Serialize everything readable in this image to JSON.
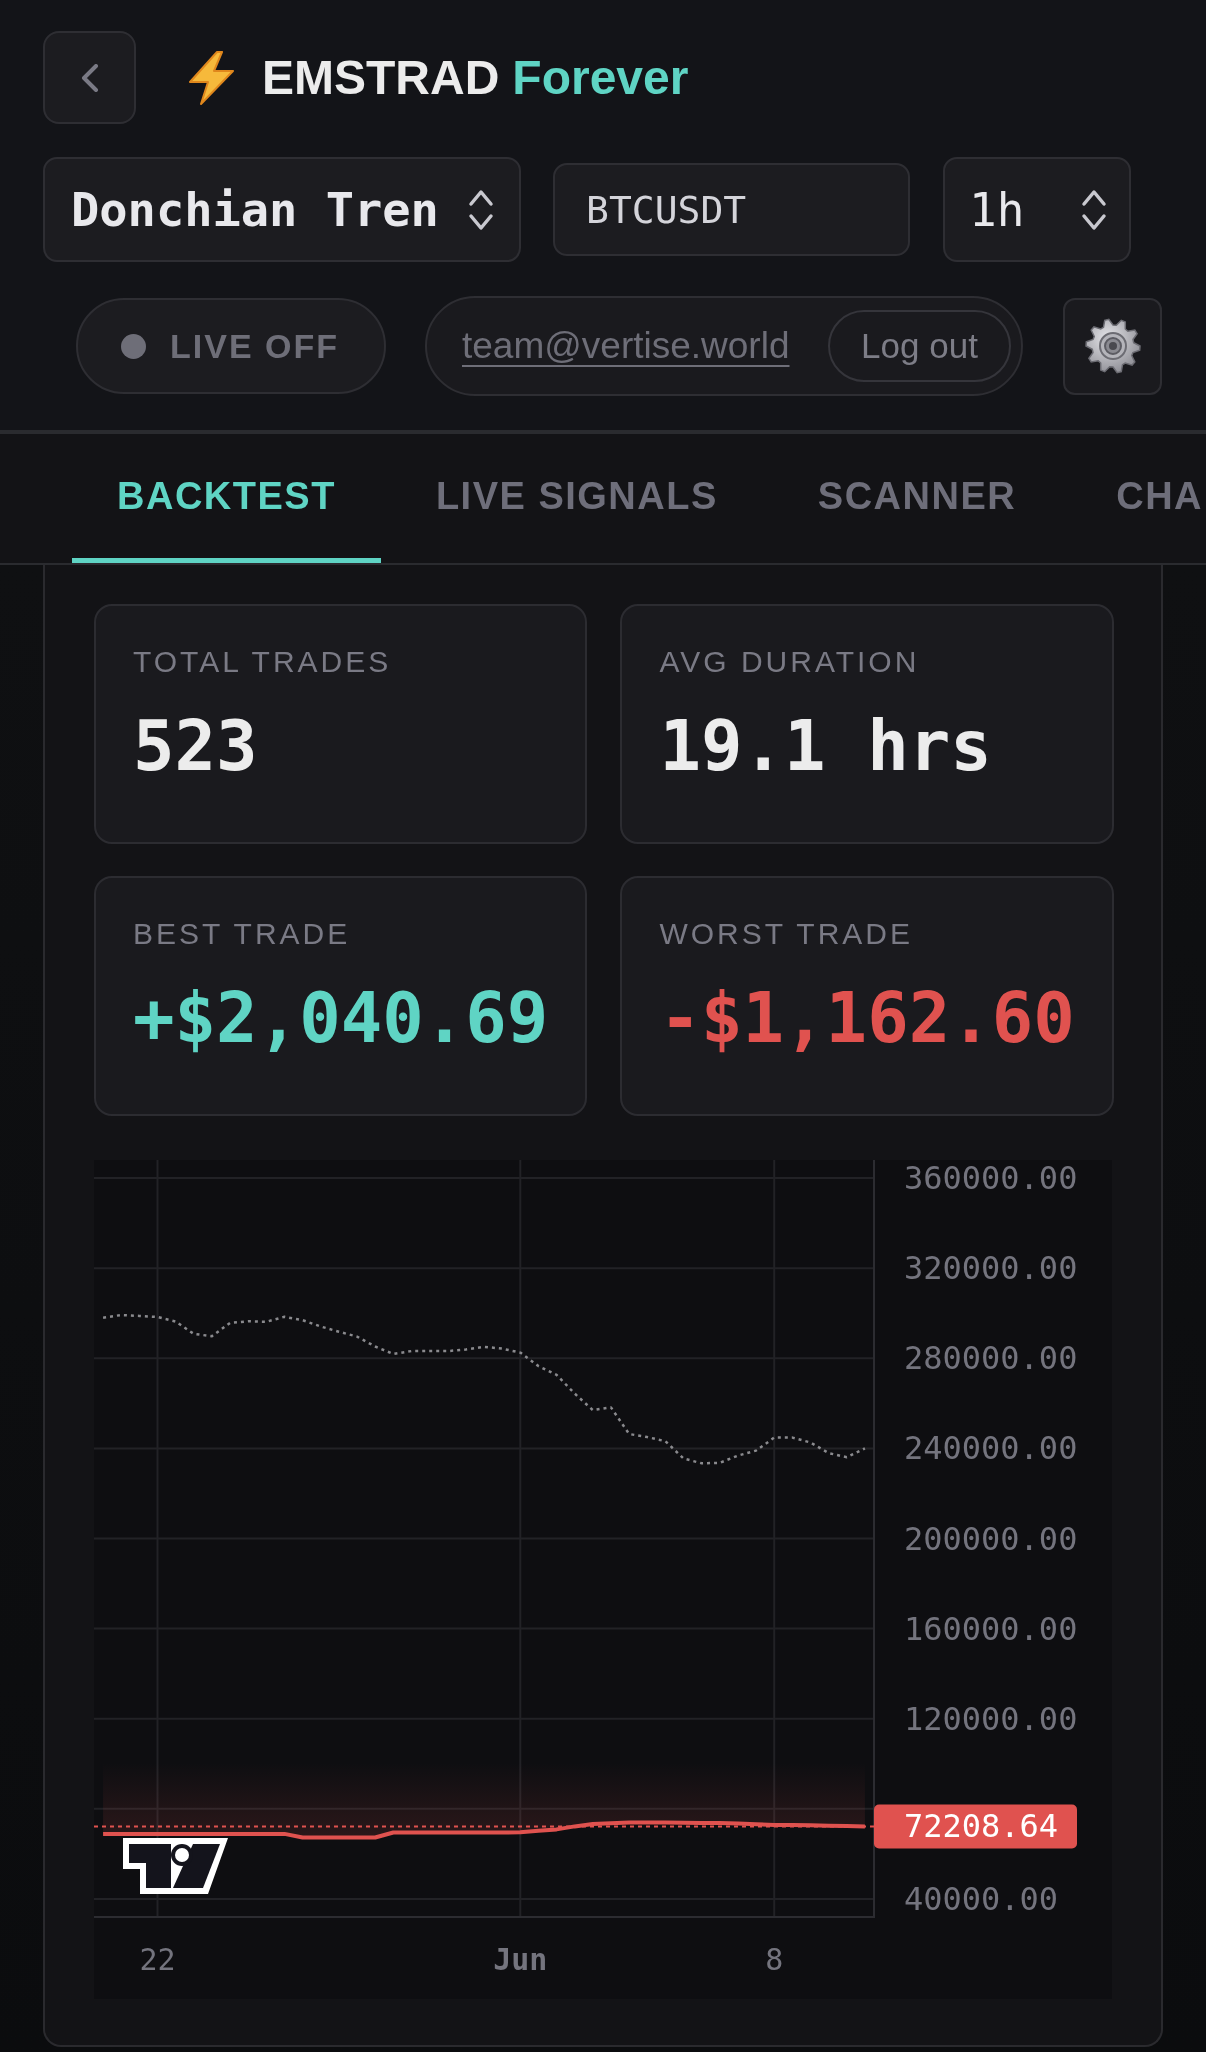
{
  "brand": {
    "name": "EMSTRAD",
    "accent": "Forever"
  },
  "controls": {
    "strategy_select": {
      "value": "Donchian Tren"
    },
    "symbol_input": {
      "value": "BTCUSDT"
    },
    "interval_select": {
      "value": "1h"
    }
  },
  "account_bar": {
    "live_toggle": {
      "label": "LIVE OFF",
      "on": false
    },
    "email": "team@vertise.world",
    "logout_button": "Log out"
  },
  "tabs": [
    {
      "label": "BACKTEST",
      "selected": true
    },
    {
      "label": "LIVE SIGNALS",
      "selected": false
    },
    {
      "label": "SCANNER",
      "selected": false
    },
    {
      "label": "CHA",
      "selected": false
    }
  ],
  "stats": [
    {
      "label": "TOTAL TRADES",
      "value": "523",
      "color": "#ececec"
    },
    {
      "label": "AVG DURATION",
      "value": "19.1 hrs",
      "color": "#ececec"
    },
    {
      "label": "BEST TRADE",
      "value": "+$2,040.69",
      "color": "#5fd4c4"
    },
    {
      "label": "WORST TRADE",
      "value": "-$1,162.60",
      "color": "#e0524f"
    }
  ],
  "chart": {
    "chart_data": {
      "type": "line",
      "grid": true,
      "categories": [
        null,
        null,
        null,
        "22",
        null,
        null,
        null,
        null,
        null,
        null,
        null,
        null,
        null,
        null,
        null,
        null,
        null,
        null,
        null,
        null,
        null,
        null,
        null,
        "Jun",
        null,
        null,
        null,
        null,
        null,
        null,
        null,
        null,
        null,
        null,
        null,
        null,
        null,
        "8",
        null,
        null,
        null,
        null,
        null
      ],
      "series": [
        {
          "color": "#8a8a8e",
          "line_style": "dotted",
          "values": [
            298000,
            299200,
            298800,
            298300,
            296300,
            290800,
            289800,
            295700,
            296400,
            296200,
            298400,
            296900,
            294100,
            291800,
            289600,
            285200,
            281900,
            283200,
            283200,
            283200,
            283900,
            285100,
            284300,
            282500,
            276500,
            272600,
            264300,
            257000,
            258200,
            246400,
            245000,
            243200,
            235500,
            233400,
            233600,
            236800,
            239000,
            244800,
            244800,
            242600,
            237900,
            236100,
            240000
          ]
        },
        {
          "color": "#e0524f",
          "line_style": "solid",
          "values": [
            68900,
            68900,
            68900,
            68900,
            68900,
            68900,
            68900,
            68900,
            68900,
            68900,
            68900,
            67300,
            67300,
            67300,
            67300,
            67300,
            69500,
            69500,
            69500,
            69500,
            69500,
            69500,
            69500,
            69600,
            70300,
            70900,
            72200,
            73300,
            73600,
            73900,
            73900,
            73900,
            73800,
            73700,
            73700,
            73500,
            73200,
            72900,
            72800,
            72700,
            72500,
            72400,
            72200
          ]
        }
      ],
      "ylim": [
        32000,
        368000
      ],
      "yticks": [
        {
          "value": 40000,
          "label": "40000.00"
        },
        {
          "value": 120000,
          "label": "120000.00"
        },
        {
          "value": 160000,
          "label": "160000.00"
        },
        {
          "value": 200000,
          "label": "200000.00"
        },
        {
          "value": 240000,
          "label": "240000.00"
        },
        {
          "value": 280000,
          "label": "280000.00"
        },
        {
          "value": 320000,
          "label": "320000.00"
        },
        {
          "value": 360000,
          "label": "360000.00"
        }
      ],
      "ref_lines": [
        {
          "axis": "y",
          "value": 72208.64,
          "label": "72208.64"
        }
      ]
    }
  }
}
